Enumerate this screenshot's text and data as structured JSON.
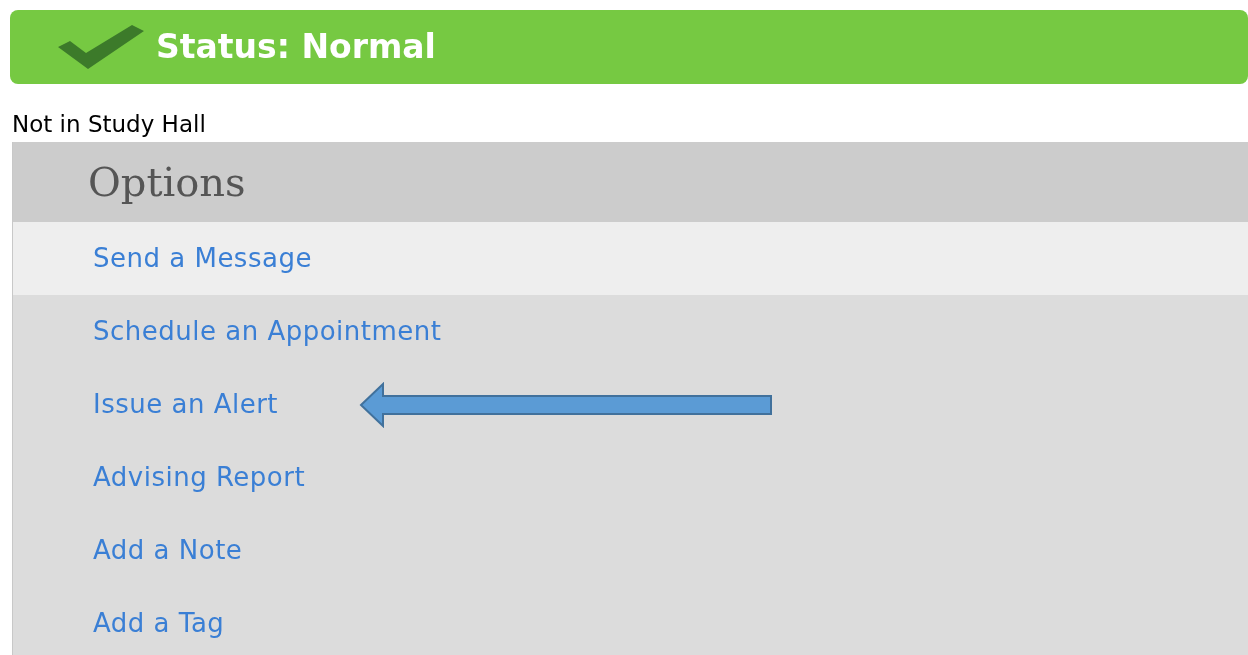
{
  "status": {
    "label": "Status: Normal"
  },
  "study_hall": "Not in Study Hall",
  "options": {
    "title": "Options",
    "items": [
      {
        "label": "Send a Message",
        "selected": true
      },
      {
        "label": "Schedule an Appointment",
        "selected": false
      },
      {
        "label": "Issue an Alert",
        "selected": false,
        "annotated": true
      },
      {
        "label": "Advising Report",
        "selected": false
      },
      {
        "label": "Add a Note",
        "selected": false
      },
      {
        "label": "Add a Tag",
        "selected": false
      }
    ]
  }
}
